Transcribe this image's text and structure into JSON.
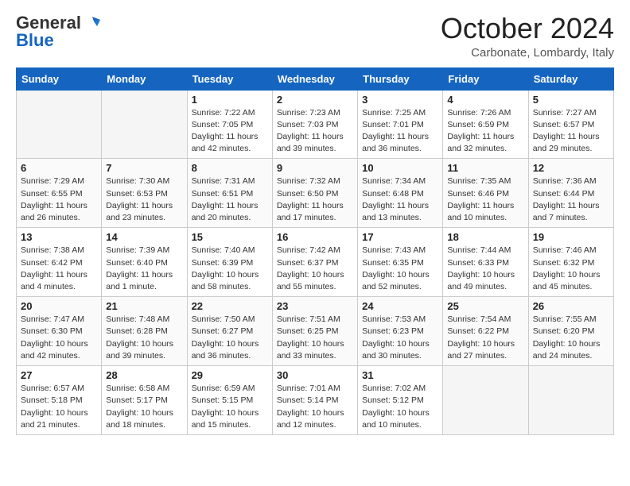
{
  "header": {
    "logo_line1": "General",
    "logo_line2": "Blue",
    "month_title": "October 2024",
    "subtitle": "Carbonate, Lombardy, Italy"
  },
  "weekdays": [
    "Sunday",
    "Monday",
    "Tuesday",
    "Wednesday",
    "Thursday",
    "Friday",
    "Saturday"
  ],
  "weeks": [
    [
      {
        "day": "",
        "info": ""
      },
      {
        "day": "",
        "info": ""
      },
      {
        "day": "1",
        "info": "Sunrise: 7:22 AM\nSunset: 7:05 PM\nDaylight: 11 hours\nand 42 minutes."
      },
      {
        "day": "2",
        "info": "Sunrise: 7:23 AM\nSunset: 7:03 PM\nDaylight: 11 hours\nand 39 minutes."
      },
      {
        "day": "3",
        "info": "Sunrise: 7:25 AM\nSunset: 7:01 PM\nDaylight: 11 hours\nand 36 minutes."
      },
      {
        "day": "4",
        "info": "Sunrise: 7:26 AM\nSunset: 6:59 PM\nDaylight: 11 hours\nand 32 minutes."
      },
      {
        "day": "5",
        "info": "Sunrise: 7:27 AM\nSunset: 6:57 PM\nDaylight: 11 hours\nand 29 minutes."
      }
    ],
    [
      {
        "day": "6",
        "info": "Sunrise: 7:29 AM\nSunset: 6:55 PM\nDaylight: 11 hours\nand 26 minutes."
      },
      {
        "day": "7",
        "info": "Sunrise: 7:30 AM\nSunset: 6:53 PM\nDaylight: 11 hours\nand 23 minutes."
      },
      {
        "day": "8",
        "info": "Sunrise: 7:31 AM\nSunset: 6:51 PM\nDaylight: 11 hours\nand 20 minutes."
      },
      {
        "day": "9",
        "info": "Sunrise: 7:32 AM\nSunset: 6:50 PM\nDaylight: 11 hours\nand 17 minutes."
      },
      {
        "day": "10",
        "info": "Sunrise: 7:34 AM\nSunset: 6:48 PM\nDaylight: 11 hours\nand 13 minutes."
      },
      {
        "day": "11",
        "info": "Sunrise: 7:35 AM\nSunset: 6:46 PM\nDaylight: 11 hours\nand 10 minutes."
      },
      {
        "day": "12",
        "info": "Sunrise: 7:36 AM\nSunset: 6:44 PM\nDaylight: 11 hours\nand 7 minutes."
      }
    ],
    [
      {
        "day": "13",
        "info": "Sunrise: 7:38 AM\nSunset: 6:42 PM\nDaylight: 11 hours\nand 4 minutes."
      },
      {
        "day": "14",
        "info": "Sunrise: 7:39 AM\nSunset: 6:40 PM\nDaylight: 11 hours\nand 1 minute."
      },
      {
        "day": "15",
        "info": "Sunrise: 7:40 AM\nSunset: 6:39 PM\nDaylight: 10 hours\nand 58 minutes."
      },
      {
        "day": "16",
        "info": "Sunrise: 7:42 AM\nSunset: 6:37 PM\nDaylight: 10 hours\nand 55 minutes."
      },
      {
        "day": "17",
        "info": "Sunrise: 7:43 AM\nSunset: 6:35 PM\nDaylight: 10 hours\nand 52 minutes."
      },
      {
        "day": "18",
        "info": "Sunrise: 7:44 AM\nSunset: 6:33 PM\nDaylight: 10 hours\nand 49 minutes."
      },
      {
        "day": "19",
        "info": "Sunrise: 7:46 AM\nSunset: 6:32 PM\nDaylight: 10 hours\nand 45 minutes."
      }
    ],
    [
      {
        "day": "20",
        "info": "Sunrise: 7:47 AM\nSunset: 6:30 PM\nDaylight: 10 hours\nand 42 minutes."
      },
      {
        "day": "21",
        "info": "Sunrise: 7:48 AM\nSunset: 6:28 PM\nDaylight: 10 hours\nand 39 minutes."
      },
      {
        "day": "22",
        "info": "Sunrise: 7:50 AM\nSunset: 6:27 PM\nDaylight: 10 hours\nand 36 minutes."
      },
      {
        "day": "23",
        "info": "Sunrise: 7:51 AM\nSunset: 6:25 PM\nDaylight: 10 hours\nand 33 minutes."
      },
      {
        "day": "24",
        "info": "Sunrise: 7:53 AM\nSunset: 6:23 PM\nDaylight: 10 hours\nand 30 minutes."
      },
      {
        "day": "25",
        "info": "Sunrise: 7:54 AM\nSunset: 6:22 PM\nDaylight: 10 hours\nand 27 minutes."
      },
      {
        "day": "26",
        "info": "Sunrise: 7:55 AM\nSunset: 6:20 PM\nDaylight: 10 hours\nand 24 minutes."
      }
    ],
    [
      {
        "day": "27",
        "info": "Sunrise: 6:57 AM\nSunset: 5:18 PM\nDaylight: 10 hours\nand 21 minutes."
      },
      {
        "day": "28",
        "info": "Sunrise: 6:58 AM\nSunset: 5:17 PM\nDaylight: 10 hours\nand 18 minutes."
      },
      {
        "day": "29",
        "info": "Sunrise: 6:59 AM\nSunset: 5:15 PM\nDaylight: 10 hours\nand 15 minutes."
      },
      {
        "day": "30",
        "info": "Sunrise: 7:01 AM\nSunset: 5:14 PM\nDaylight: 10 hours\nand 12 minutes."
      },
      {
        "day": "31",
        "info": "Sunrise: 7:02 AM\nSunset: 5:12 PM\nDaylight: 10 hours\nand 10 minutes."
      },
      {
        "day": "",
        "info": ""
      },
      {
        "day": "",
        "info": ""
      }
    ]
  ]
}
